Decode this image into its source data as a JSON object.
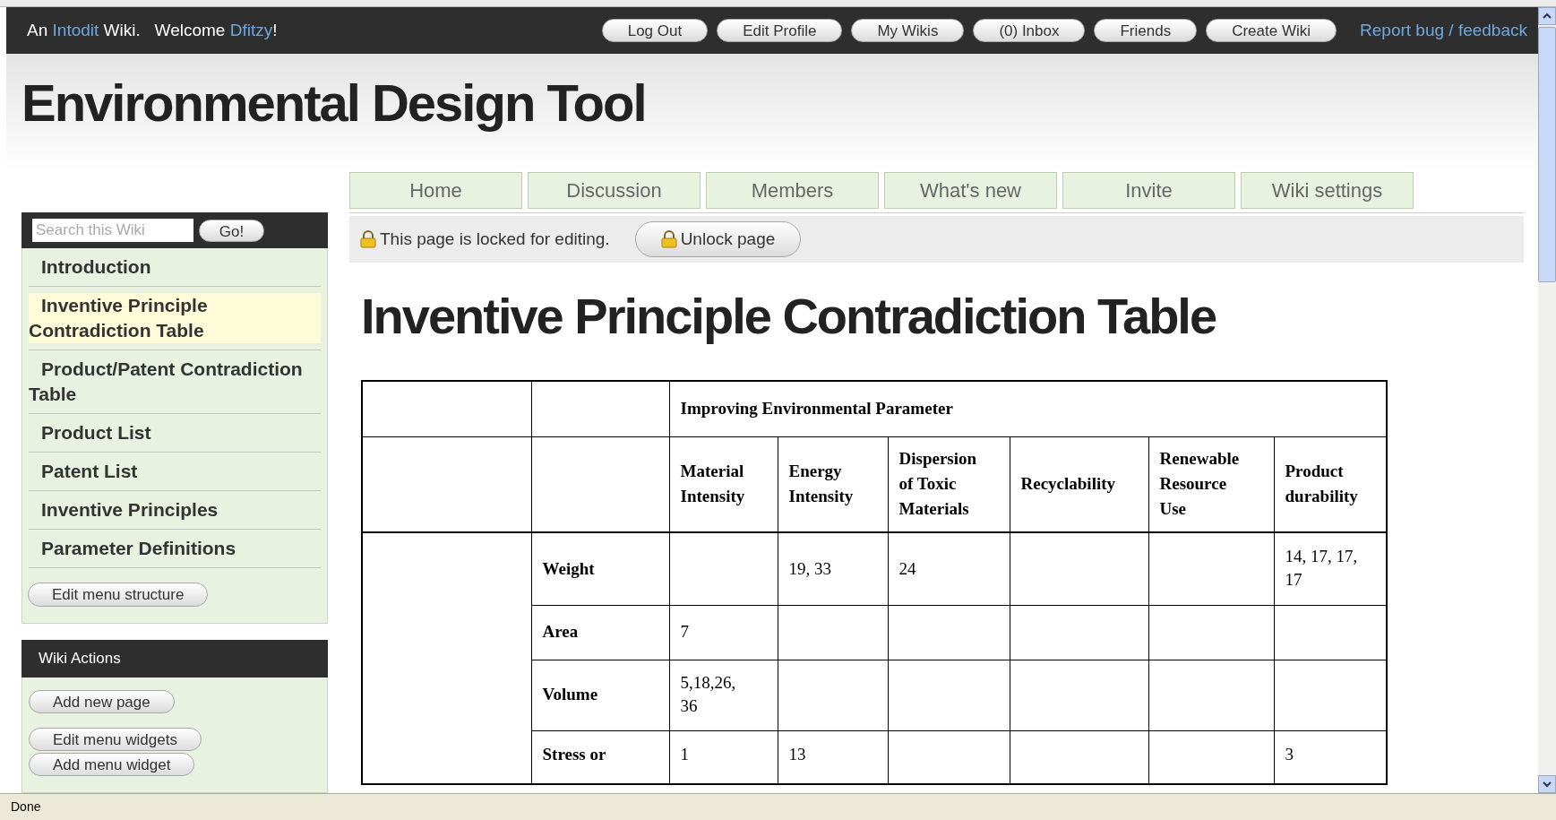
{
  "top_bar": {
    "greeting": {
      "before": "An ",
      "site": "Intodit",
      "middle": " Wiki.   Welcome ",
      "user": "Dfitzy",
      "after": "!"
    },
    "buttons": [
      "Log Out",
      "Edit Profile",
      "My Wikis",
      "(0) Inbox",
      "Friends",
      "Create Wiki"
    ],
    "report_link": "Report bug / feedback"
  },
  "site_title": "Environmental Design Tool",
  "search": {
    "placeholder": "Search this Wiki",
    "button": "Go!"
  },
  "sidebar": {
    "items": [
      {
        "label": "Introduction",
        "selected": false
      },
      {
        "label": "Inventive Principle Contradiction Table",
        "selected": true
      },
      {
        "label": "Product/Patent Contradiction Table",
        "selected": false
      },
      {
        "label": "Product List",
        "selected": false
      },
      {
        "label": "Patent List",
        "selected": false
      },
      {
        "label": "Inventive Principles",
        "selected": false
      },
      {
        "label": "Parameter Definitions",
        "selected": false
      }
    ],
    "edit_button": "Edit menu structure"
  },
  "wiki_actions": {
    "title": "Wiki Actions",
    "buttons": [
      "Add new page",
      "Edit menu widgets",
      "Add menu widget"
    ]
  },
  "tabs": [
    {
      "label": "Home",
      "selected": false
    },
    {
      "label": "Discussion",
      "selected": false
    },
    {
      "label": "Members",
      "selected": false
    },
    {
      "label": "What's new",
      "selected": false
    },
    {
      "label": "Invite",
      "selected": false
    },
    {
      "label": "Wiki settings",
      "selected": false
    }
  ],
  "lock_notice": {
    "text": "This page is locked for editing.",
    "button": "Unlock page"
  },
  "page_title": "Inventive Principle Contradiction Table",
  "table": {
    "group_header": "Improving Environmental Parameter",
    "columns": [
      "Material Intensity",
      "Energy Intensity",
      "Dispersion of Toxic Materials",
      "Recyclability",
      "Renewable Resource Use",
      "Product durability"
    ],
    "rows": [
      {
        "label": "Weight",
        "cells": [
          null,
          "19, 33",
          "24",
          null,
          null,
          "14, 17, 17, 17"
        ]
      },
      {
        "label": "Area",
        "cells": [
          "7",
          null,
          null,
          null,
          null,
          null
        ]
      },
      {
        "label": "Volume",
        "cells": [
          "5,18,26, 36",
          null,
          null,
          null,
          null,
          null
        ]
      },
      {
        "label": "Stress or",
        "cells": [
          "1",
          "13",
          null,
          null,
          null,
          "3"
        ]
      }
    ]
  },
  "status_bar": "Done"
}
